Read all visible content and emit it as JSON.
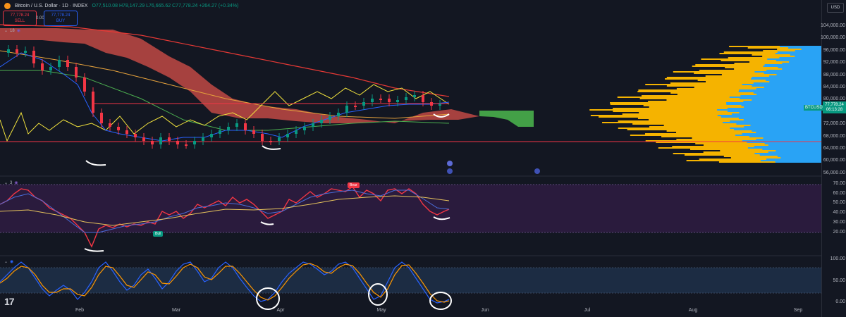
{
  "header": {
    "symbol": "Bitcoin / U.S. Dollar · 1D · INDEX",
    "ohlc": "O77,510.08 H78,147.29 L76,665.62 C77,778.24 +264.27 (+0.34%)",
    "sell_price": "77,778.24",
    "sell_label": "SELL",
    "buy_price": "77,778.24",
    "buy_label": "BUY",
    "spread": "0.00"
  },
  "panes": {
    "main_tag": "18",
    "rsi_tag": "3",
    "stoch_tag": "3"
  },
  "right_axis": {
    "currency": "USD",
    "last_price": "77,778.24",
    "countdown": "06:13:28",
    "symbol_tag": "BTCUSD",
    "price_ticks": [
      "104,000.00",
      "100,000.00",
      "96,000.00",
      "92,000.00",
      "88,000.00",
      "84,000.00",
      "80,000.00",
      "76,000.00",
      "72,000.00",
      "68,000.00",
      "64,000.00",
      "60,000.00",
      "56,000.00"
    ],
    "rsi_ticks": [
      "70.00",
      "60.00",
      "50.00",
      "40.00",
      "30.00",
      "20.00"
    ],
    "stoch_ticks": [
      "100.00",
      "50.00",
      "0.00"
    ]
  },
  "x_axis": [
    "Feb",
    "Mar",
    "Apr",
    "May",
    "Jun",
    "Jul",
    "Aug",
    "Sep"
  ],
  "labels": {
    "bull": "Bull",
    "bear": "Bear"
  },
  "colors": {
    "background": "#131722",
    "up": "#089981",
    "down": "#f23645",
    "cloud_bear": "#e5544c",
    "cloud_bull": "#43a047",
    "volume_profile_up": "#f5b300",
    "volume_profile_down": "#29a3f5",
    "rsi_band": "#2a1b3d"
  },
  "icons": [
    "tradingview-logo",
    "bitcoin-icon",
    "flag-icon",
    "lightning-icon",
    "eye-icon"
  ]
}
